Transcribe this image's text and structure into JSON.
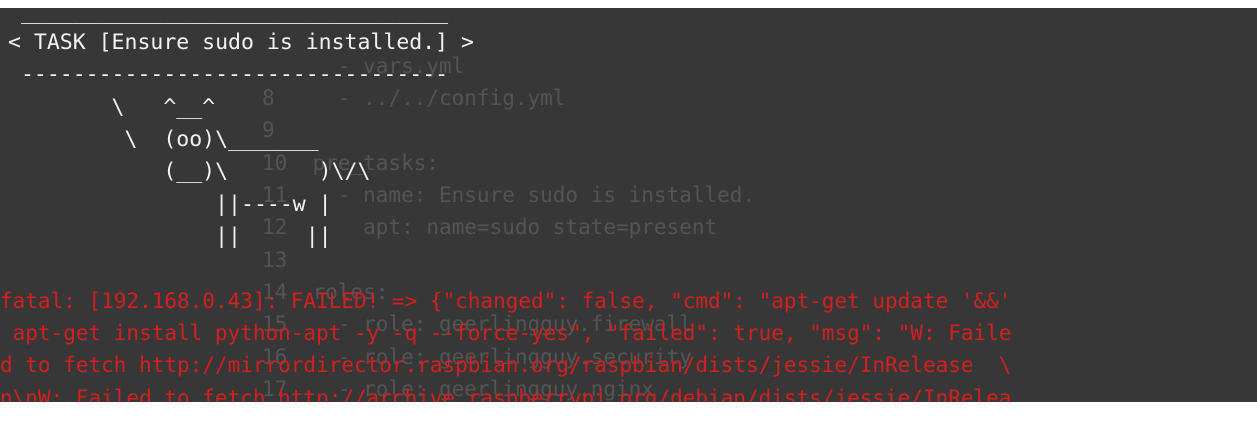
{
  "background_editor": {
    "lines": [
      "      - vars.yml",
      "8     - ../../config.yml",
      "9",
      "10  pre_tasks:",
      "11    - name: Ensure sudo is installed.",
      "12      apt: name=sudo state=present",
      "13",
      "14  roles:",
      "15    - role: geerlingguy.firewall",
      "16    - role: geerlingguy.security",
      "17    - role: geerlingguy.nginx"
    ]
  },
  "cowsay": {
    "top_border": " _________________________________",
    "task_line": "< TASK [Ensure sudo is installed.] >",
    "bottom_border": " ---------------------------------",
    "cow_lines": [
      "        \\   ^__^",
      "         \\  (oo)\\_______",
      "            (__)\\       )\\/\\",
      "                ||----w |",
      "                ||     ||"
    ]
  },
  "error_output": {
    "lines": [
      "fatal: [192.168.0.43]: FAILED! => {\"changed\": false, \"cmd\": \"apt-get update '&&'",
      " apt-get install python-apt -y -q --force-yes\", \"failed\": true, \"msg\": \"W: Faile",
      "d to fetch http://mirrordirector.raspbian.org/raspbian/dists/jessie/InRelease  \\",
      "n\\nW: Failed to fetch http://archive.raspberrypi.org/debian/dists/jessie/InRelea"
    ]
  },
  "colors": {
    "terminal_bg": "#373737",
    "foreground": "#f2f2f2",
    "ghost_text": "#545454",
    "error_red": "#d41f1f"
  }
}
